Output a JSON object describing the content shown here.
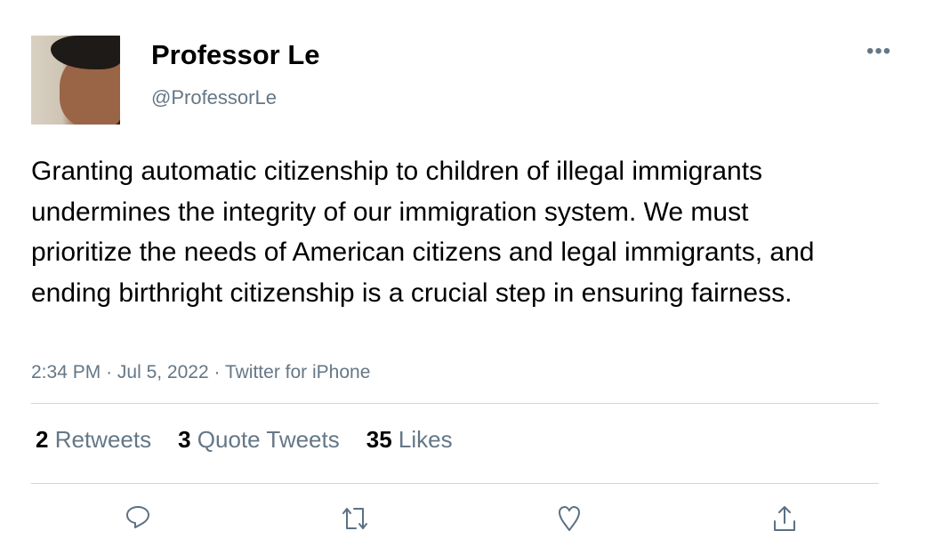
{
  "tweet": {
    "author_name": "Professor Le",
    "author_handle": "@ProfessorLe",
    "more_icon": "ellipsis-icon",
    "text": "Granting automatic citizenship to children of illegal immigrants undermines the integrity of our immigration system. We must prioritize the needs of American citizens and legal immigrants, and ending birthright citizenship is a crucial step in ensuring fairness.",
    "time": "2:34 PM",
    "date": "Jul 5, 2022",
    "source": "Twitter for iPhone",
    "sep": "·"
  },
  "stats": {
    "retweets_count": "2",
    "retweets_label": "Retweets",
    "quotes_count": "3",
    "quotes_label": "Quote Tweets",
    "likes_count": "35",
    "likes_label": "Likes"
  },
  "colors": {
    "secondary": "#657786",
    "divider": "#ccd6dd"
  }
}
